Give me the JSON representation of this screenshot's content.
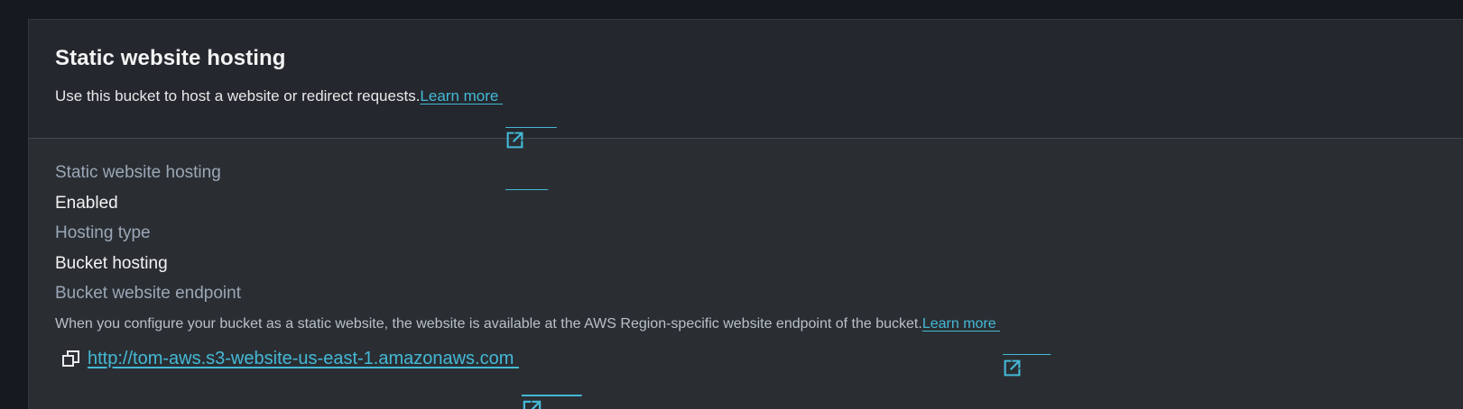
{
  "section": {
    "title": "Static website hosting",
    "description": "Use this bucket to host a website or redirect requests. ",
    "learn_more": "Learn more "
  },
  "details": {
    "hosting_label": "Static website hosting",
    "hosting_value": "Enabled",
    "type_label": "Hosting type",
    "type_value": "Bucket hosting",
    "endpoint_label": "Bucket website endpoint",
    "endpoint_desc": "When you configure your bucket as a static website, the website is available at the AWS Region-specific website endpoint of the bucket. ",
    "endpoint_learn_more": "Learn more ",
    "endpoint_url": "http://tom-aws.s3-website-us-east-1.amazonaws.com "
  },
  "icons": {
    "external_link": "external-link-icon",
    "copy": "copy-icon"
  },
  "colors": {
    "background": "#16191f",
    "panel": "#2a2e33",
    "header": "#24272d",
    "link": "#44b9d6",
    "label": "#9ba7b6",
    "value": "#f2f3f3"
  }
}
